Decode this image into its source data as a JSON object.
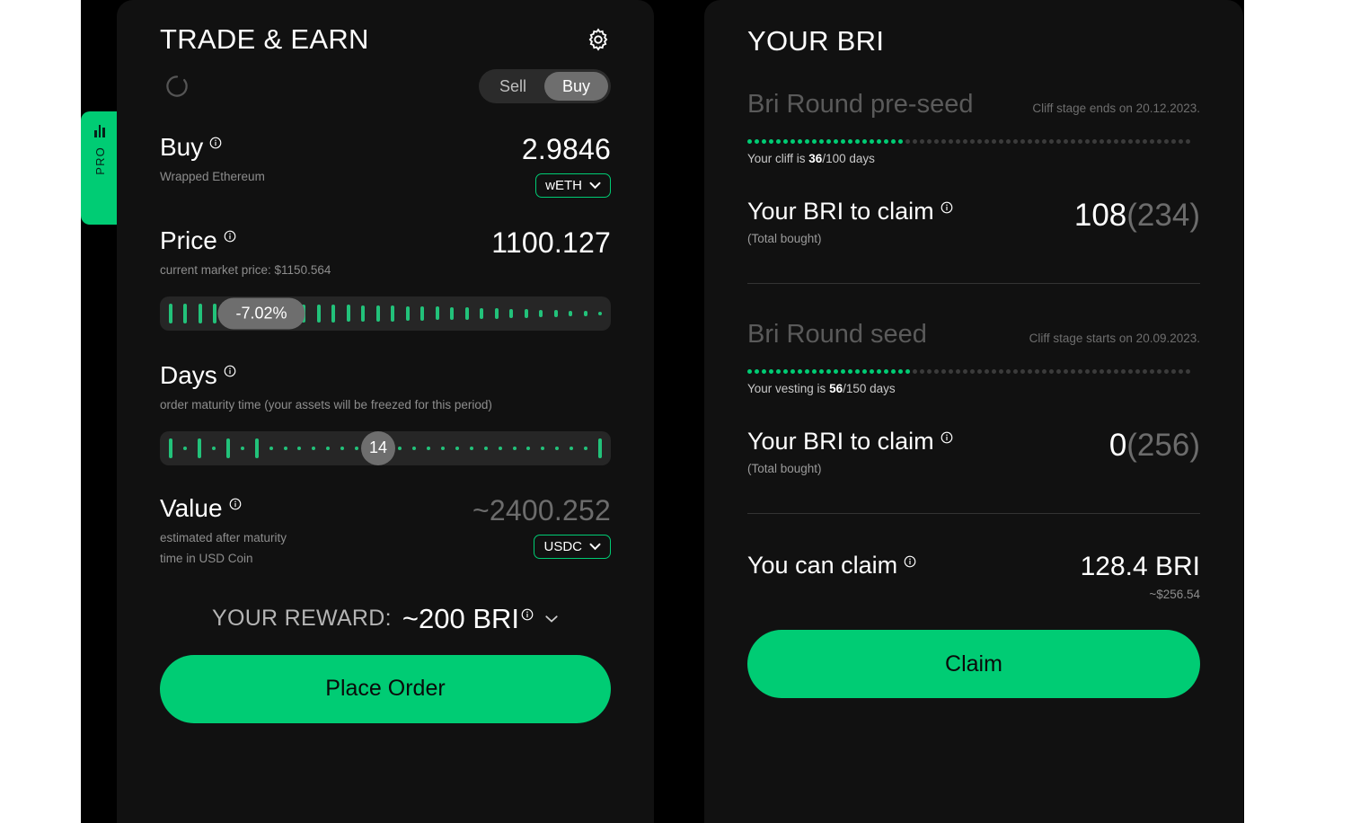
{
  "sidebar": {
    "pro_label": "PRO",
    "icon": "bar-chart-icon"
  },
  "left_panel": {
    "title": "TRADE & EARN",
    "settings_icon": "gear-icon",
    "loading_icon": "spinner-icon",
    "mode_toggle": {
      "options": [
        "Sell",
        "Buy"
      ],
      "selected": "Buy"
    },
    "buy": {
      "label": "Buy",
      "sub": "Wrapped Ethereum",
      "amount": "2.9846",
      "token": "wETH",
      "info_icon": "info-icon",
      "chevron_icon": "chevron-down-icon"
    },
    "price": {
      "label": "Price",
      "sub": "current market price: $1150.564",
      "amount": "1100.127",
      "slider_value": "-7.02%",
      "info_icon": "info-icon"
    },
    "days": {
      "label": "Days",
      "sub": "order maturity time (your assets will be freezed for this period)",
      "slider_value": "14",
      "info_icon": "info-icon"
    },
    "value": {
      "label": "Value",
      "sub_line1": "estimated after maturity",
      "sub_line2": "time in USD Coin",
      "amount": "~2400.252",
      "token": "USDC",
      "info_icon": "info-icon",
      "chevron_icon": "chevron-down-icon"
    },
    "reward": {
      "label": "YOUR REWARD:",
      "value": "~200 BRI",
      "info_icon": "info-icon",
      "chevron_icon": "chevron-down-icon"
    },
    "place_order_label": "Place Order"
  },
  "right_panel": {
    "title": "YOUR BRI",
    "rounds": [
      {
        "name": "Bri Round pre-seed",
        "date_note": "Cliff stage ends on 20.12.2023.",
        "progress_note_prefix": "Your cliff is ",
        "progress_value": "36",
        "progress_note_suffix": "/100 days",
        "progress_percent": 36,
        "claim_label": "Your BRI to claim",
        "claim_sub": "(Total bought)",
        "claim_value": "108",
        "claim_total": "(234)",
        "info_icon": "info-icon"
      },
      {
        "name": "Bri Round seed",
        "date_note": "Cliff stage starts on 20.09.2023.",
        "progress_note_prefix": "Your vesting is ",
        "progress_value": "56",
        "progress_note_suffix": "/150 days",
        "progress_percent": 37,
        "claim_label": "Your BRI to claim",
        "claim_sub": "(Total bought)",
        "claim_value": "0",
        "claim_total": "(256)",
        "info_icon": "info-icon"
      }
    ],
    "claimable": {
      "label": "You can claim",
      "amount": "128.4 BRI",
      "usd": "~$256.54",
      "info_icon": "info-icon"
    },
    "claim_button_label": "Claim"
  },
  "colors": {
    "accent": "#00CC74",
    "panel_bg": "#111111",
    "page_bg": "#000000",
    "tick": "#22c27a",
    "muted": "#6c6c6c"
  }
}
